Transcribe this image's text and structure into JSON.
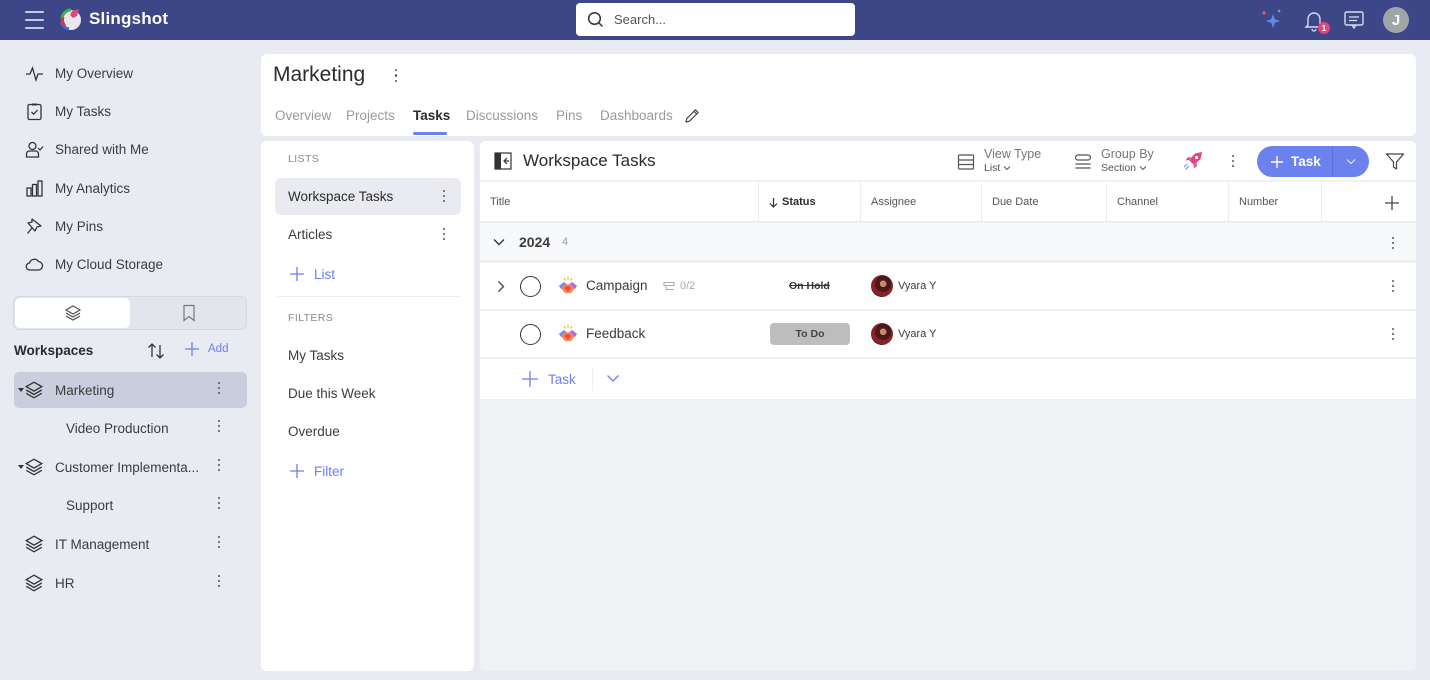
{
  "app": {
    "brand": "Slingshot",
    "search_placeholder": "Search...",
    "notification_count": "1",
    "user_initial": "J",
    "accent_color": "#6b81ee",
    "topbar_color": "#3d4787"
  },
  "sidebar": {
    "nav": [
      {
        "label": "My Overview",
        "icon": "activity-icon"
      },
      {
        "label": "My Tasks",
        "icon": "clipboard-check-icon"
      },
      {
        "label": "Shared with Me",
        "icon": "user-check-icon"
      },
      {
        "label": "My Analytics",
        "icon": "bar-chart-icon"
      },
      {
        "label": "My Pins",
        "icon": "pin-icon"
      },
      {
        "label": "My Cloud Storage",
        "icon": "cloud-icon"
      }
    ],
    "workspaces_label": "Workspaces",
    "add_label": "Add",
    "workspaces": [
      {
        "label": "Marketing",
        "level": 0,
        "expanded": true,
        "active": true
      },
      {
        "label": "Video Production",
        "level": 1
      },
      {
        "label": "Customer Implementa...",
        "level": 0,
        "expanded": true
      },
      {
        "label": "Support",
        "level": 1
      },
      {
        "label": "IT Management",
        "level": 0
      },
      {
        "label": "HR",
        "level": 0
      }
    ]
  },
  "header": {
    "title": "Marketing",
    "tabs": [
      {
        "label": "Overview"
      },
      {
        "label": "Projects"
      },
      {
        "label": "Tasks",
        "active": true
      },
      {
        "label": "Discussions"
      },
      {
        "label": "Pins"
      },
      {
        "label": "Dashboards"
      }
    ]
  },
  "lists_panel": {
    "lists_label": "LISTS",
    "lists": [
      {
        "label": "Workspace Tasks",
        "active": true
      },
      {
        "label": "Articles"
      }
    ],
    "add_list_label": "List",
    "filters_label": "FILTERS",
    "filters": [
      {
        "label": "My Tasks"
      },
      {
        "label": "Due this Week"
      },
      {
        "label": "Overdue"
      }
    ],
    "add_filter_label": "Filter"
  },
  "main": {
    "title": "Workspace Tasks",
    "view_type_label": "View Type",
    "view_type_value": "List",
    "group_by_label": "Group By",
    "group_by_value": "Section",
    "add_task_label": "Task",
    "columns": [
      "Title",
      "Status",
      "Assignee",
      "Due Date",
      "Channel",
      "Number"
    ],
    "sorted_column": "Status",
    "group": {
      "name": "2024",
      "count": "4"
    },
    "tasks": [
      {
        "title": "Campaign",
        "subtasks": "0/2",
        "status": "On Hold",
        "assignee": "Vyara Y",
        "has_children": true
      },
      {
        "title": "Feedback",
        "status": "To Do",
        "assignee": "Vyara Y"
      }
    ],
    "add_row_label": "Task"
  }
}
